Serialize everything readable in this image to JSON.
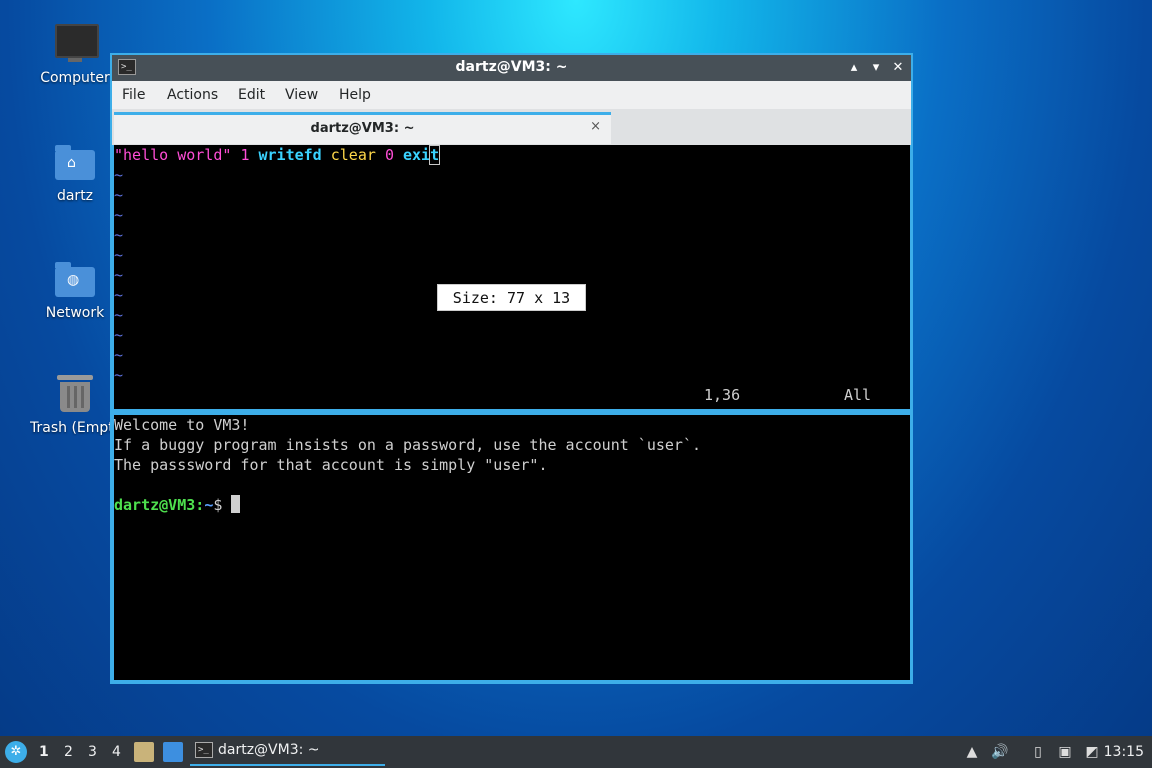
{
  "desktop": {
    "icons": [
      {
        "label": "Computer",
        "icon": "computer-icon"
      },
      {
        "label": "dartz",
        "icon": "home-folder-icon"
      },
      {
        "label": "Network",
        "icon": "network-folder-icon"
      },
      {
        "label": "Trash (Empty)",
        "icon": "trash-icon"
      }
    ]
  },
  "window": {
    "title": "dartz@VM3: ~",
    "menu": [
      "File",
      "Actions",
      "Edit",
      "View",
      "Help"
    ],
    "tab_title": "dartz@VM3: ~",
    "tab_close": "×",
    "buttons": {
      "minimize": "▴",
      "maximize": "▾",
      "close": "✕"
    }
  },
  "editor": {
    "line1": {
      "str": "\"hello world\"",
      "n1": "1",
      "kw1": "writefd",
      "kw2": "clear",
      "n2": "0",
      "kw3_pre": "exi",
      "kw3_cur": "t"
    },
    "tilde": "~",
    "size_popup": "Size: 77 x 13",
    "status_pos": "1,36",
    "status_all": "All"
  },
  "shell": {
    "welcome": "Welcome to VM3!",
    "line2": "If a buggy program insists on a password, use the account `user`.",
    "line3": "The passsword for that account is simply \"user\".",
    "prompt_user": "dartz@VM3",
    "prompt_sep": ":",
    "prompt_path": "~",
    "prompt_end": "$ "
  },
  "taskbar": {
    "desktops": [
      "1",
      "2",
      "3",
      "4"
    ],
    "task_label": "dartz@VM3: ~",
    "clock": "13:15"
  }
}
